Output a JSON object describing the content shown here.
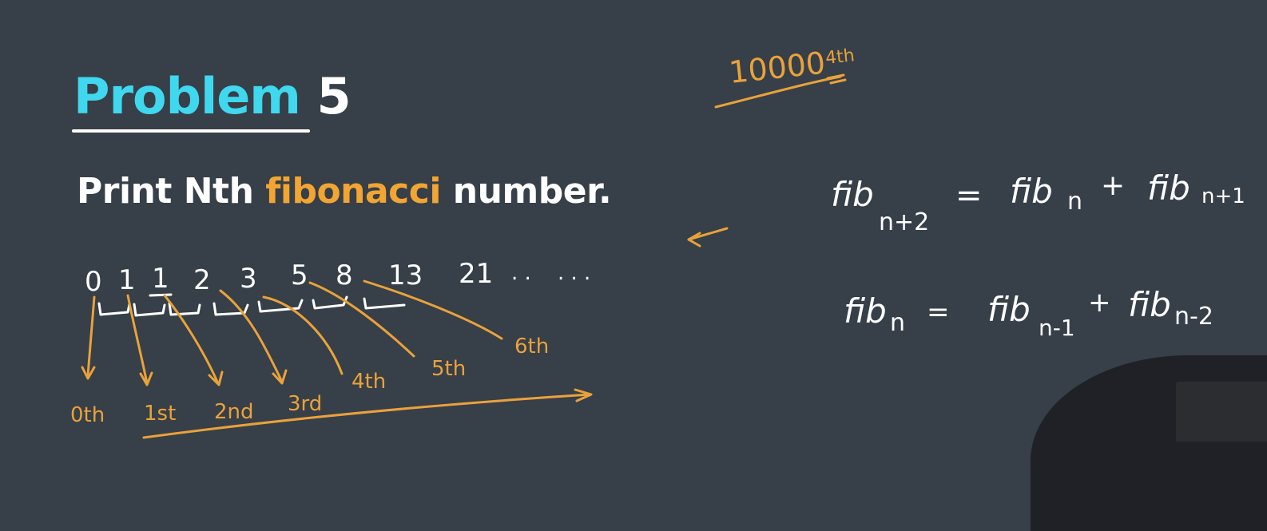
{
  "slide": {
    "title_word": "Problem",
    "title_number": "5",
    "statement_pre": "Print Nth ",
    "statement_highlight": "fibonacci",
    "statement_post": " number."
  },
  "annotations": {
    "sequence": [
      "0",
      "1",
      "1",
      "2",
      "3",
      "5",
      "8",
      "13",
      "21",
      ". .",
      ". . ."
    ],
    "ordinals": [
      "0th",
      "1st",
      "2nd",
      "3rd",
      "4th",
      "5th",
      "6th"
    ],
    "big_index": "10000",
    "big_index_suffix": "4th",
    "formula1": {
      "lhs": "fib",
      "lhs_sub": "n+2",
      "eq": "=",
      "t1": "fib",
      "t1_sub": "n",
      "op": "+",
      "t2": "fib",
      "t2_sub": "n+1"
    },
    "formula2": {
      "lhs": "fib",
      "lhs_sub": "n",
      "eq": "=",
      "t1": "fib",
      "t1_sub": "n-1",
      "op": "+",
      "t2": "fib",
      "t2_sub": "n-2"
    }
  },
  "colors": {
    "background": "#373f48",
    "title_accent": "#3fd8ee",
    "highlight": "#f2a533",
    "ink_white": "#ffffff",
    "ink_orange": "#e9a23b"
  }
}
